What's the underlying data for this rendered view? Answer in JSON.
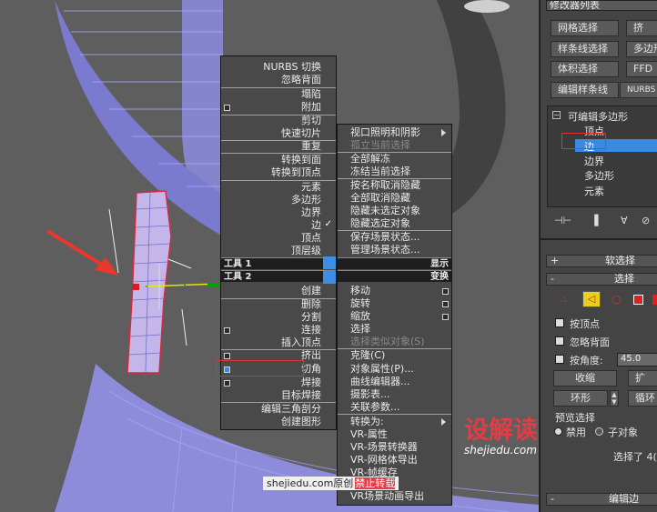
{
  "modifier_list": "修改器列表",
  "panel_buttons": [
    "网格选择",
    "挤",
    "样条线选择",
    "多边形",
    "体积选择",
    "FFD",
    "编辑样条线",
    "NURBS 曲"
  ],
  "stack": {
    "root": "可编辑多边形",
    "items": [
      "顶点",
      "边",
      "边界",
      "多边形",
      "元素"
    ],
    "selected_index": 1
  },
  "soft_select": "软选择",
  "select_rollout": "选择",
  "select_opts": {
    "by_vertex": "按顶点",
    "ignore_backfacing": "忽略背面",
    "by_angle": "按角度:",
    "angle_value": "45.0",
    "shrink": "收缩",
    "grow": "扩",
    "ring": "环形",
    "loop": "循环",
    "preview": "预览选择",
    "disabled": "禁用",
    "subobject": "子对象",
    "selected": "选择了 4("
  },
  "edit_edges": "编辑边",
  "left_menu": {
    "g1": [
      "NURBS 切换",
      "忽略背面",
      "塌陷",
      "附加",
      "剪切",
      "快速切片",
      "重复",
      "转换到面",
      "转换到顶点",
      "元素",
      "多边形",
      "边界",
      "边",
      "顶点",
      "顶层级"
    ],
    "tools1": "工具 1",
    "display": "显示",
    "tools2": "工具 2",
    "transform": "变换",
    "g2": [
      "创建",
      "删除",
      "分割",
      "连接",
      "插入顶点",
      "挤出",
      "切角",
      "焊接",
      "目标焊接",
      "编辑三角剖分",
      "创建图形"
    ]
  },
  "right_menu": {
    "g1": [
      "视口照明和阴影",
      "孤立当前选择",
      "全部解冻",
      "冻结当前选择",
      "按名称取消隐藏",
      "全部取消隐藏",
      "隐藏未选定对象",
      "隐藏选定对象",
      "保存场景状态...",
      "管理场景状态..."
    ],
    "g2": [
      "移动",
      "旋转",
      "缩放",
      "选择",
      "选择类似对象(S)",
      "克隆(C)",
      "对象属性(P)...",
      "曲线编辑器...",
      "摄影表...",
      "关联参数...",
      "转换为:",
      "VR-属性",
      "VR-场景转换器",
      "VR-网格体导出",
      "VR-帧缓存",
      "VR场景动画导出"
    ]
  },
  "watermark": {
    "logo": "设解读",
    "url": "shejiedu.com",
    "credit": "shejiedu.com原创",
    "forbid": "禁止转载"
  }
}
